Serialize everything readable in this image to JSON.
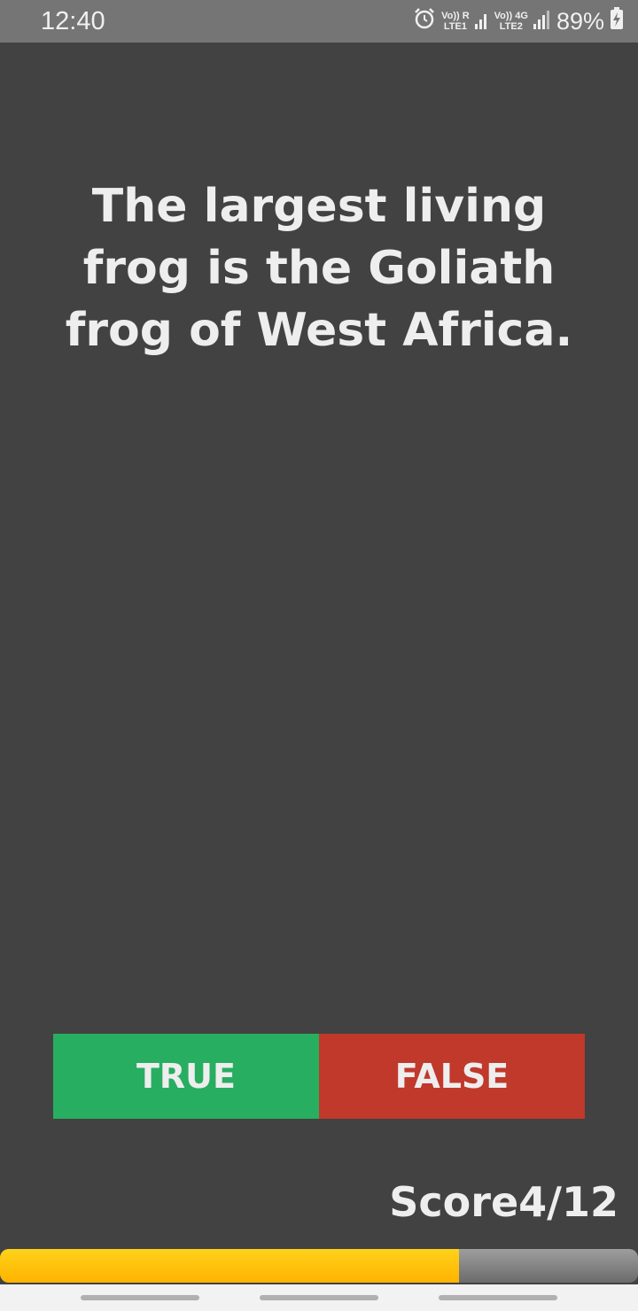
{
  "status_bar": {
    "time": "12:40",
    "sim1_label_top": "Vo)) R",
    "sim1_label_bottom": "LTE1",
    "sim2_label_top": "Vo)) 4G",
    "sim2_label_bottom": "LTE2",
    "battery": "89%",
    "icons": [
      "alarm-icon",
      "signal-icon",
      "battery-charging-icon"
    ]
  },
  "quiz": {
    "question": "The largest living frog is the Goliath frog of West Africa.",
    "true_label": "TRUE",
    "false_label": "FALSE",
    "score_label": "Score4/12",
    "progress_fraction": 0.72
  },
  "colors": {
    "background": "#424242",
    "true": "#27ae60",
    "false": "#c0392b",
    "progress": "#ffc107"
  }
}
